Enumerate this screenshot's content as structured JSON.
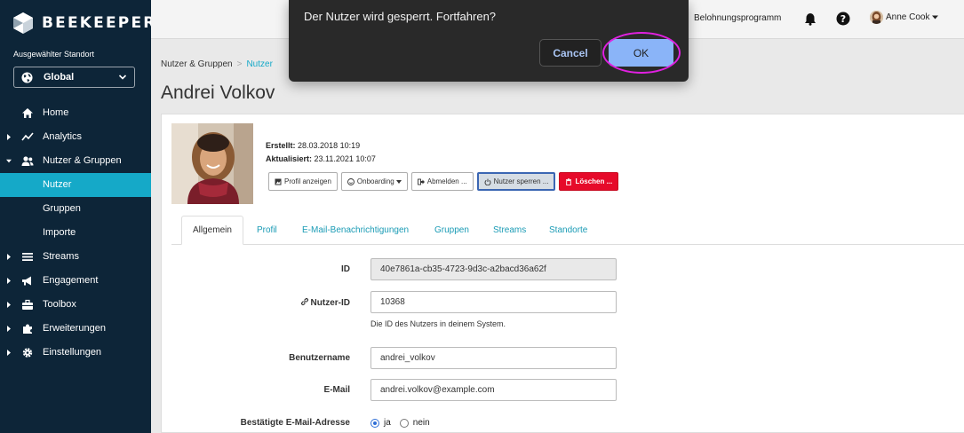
{
  "brand": {
    "name": "BEEKEEPER"
  },
  "sidebar": {
    "location_label": "Ausgewählter Standort",
    "location_value": "Global",
    "items": [
      {
        "label": "Home",
        "icon": "home-icon",
        "caret": false,
        "active": false,
        "sub": false
      },
      {
        "label": "Analytics",
        "icon": "chart-line-icon",
        "caret": true,
        "active": false,
        "sub": false
      },
      {
        "label": "Nutzer & Gruppen",
        "icon": "users-icon",
        "caret": true,
        "active": false,
        "sub": false
      },
      {
        "label": "Nutzer",
        "icon": "",
        "caret": false,
        "active": true,
        "sub": true
      },
      {
        "label": "Gruppen",
        "icon": "",
        "caret": false,
        "active": false,
        "sub": true
      },
      {
        "label": "Importe",
        "icon": "",
        "caret": false,
        "active": false,
        "sub": true
      },
      {
        "label": "Streams",
        "icon": "streams-icon",
        "caret": true,
        "active": false,
        "sub": false
      },
      {
        "label": "Engagement",
        "icon": "megaphone-icon",
        "caret": true,
        "active": false,
        "sub": false
      },
      {
        "label": "Toolbox",
        "icon": "toolbox-icon",
        "caret": true,
        "active": false,
        "sub": false
      },
      {
        "label": "Erweiterungen",
        "icon": "puzzle-icon",
        "caret": true,
        "active": false,
        "sub": false
      },
      {
        "label": "Einstellungen",
        "icon": "gear-icon",
        "caret": true,
        "active": false,
        "sub": false
      }
    ]
  },
  "topbar": {
    "reward_label": "Belohnungsprogramm",
    "user_name": "Anne Cook"
  },
  "breadcrumb": {
    "parent": "Nutzer & Gruppen",
    "separator": ">",
    "current": "Nutzer"
  },
  "page": {
    "title": "Andrei Volkov"
  },
  "profile": {
    "created_label": "Erstellt:",
    "created_value": "28.03.2018 10:19",
    "updated_label": "Aktualisiert:",
    "updated_value": "23.11.2021 10:07"
  },
  "actions": {
    "view_profile": "Profil anzeigen",
    "onboarding": "Onboarding",
    "logout": "Abmelden ...",
    "lock": "Nutzer sperren ...",
    "delete": "Löschen ..."
  },
  "tabs": [
    "Allgemein",
    "Profil",
    "E-Mail-Benachrichtigungen",
    "Gruppen",
    "Streams",
    "Standorte"
  ],
  "form": {
    "id_label": "ID",
    "id_value": "40e7861a-cb35-4723-9d3c-a2bacd36a62f",
    "user_id_label": "Nutzer-ID",
    "user_id_value": "10368",
    "user_id_help": "Die ID des Nutzers in deinem System.",
    "username_label": "Benutzername",
    "username_value": "andrei_volkov",
    "email_label": "E-Mail",
    "email_value": "andrei.volkov@example.com",
    "email_confirmed_label": "Bestätigte E-Mail-Adresse",
    "yes": "ja",
    "no": "nein"
  },
  "dialog": {
    "message": "Der Nutzer wird gesperrt. Fortfahren?",
    "cancel": "Cancel",
    "ok": "OK"
  },
  "colors": {
    "sidebar": "#0d2538",
    "accent": "#15a9c8",
    "danger": "#e60a2a",
    "dialog": "#292929",
    "ok": "#8ab4f8",
    "highlight": "#e020e0"
  }
}
